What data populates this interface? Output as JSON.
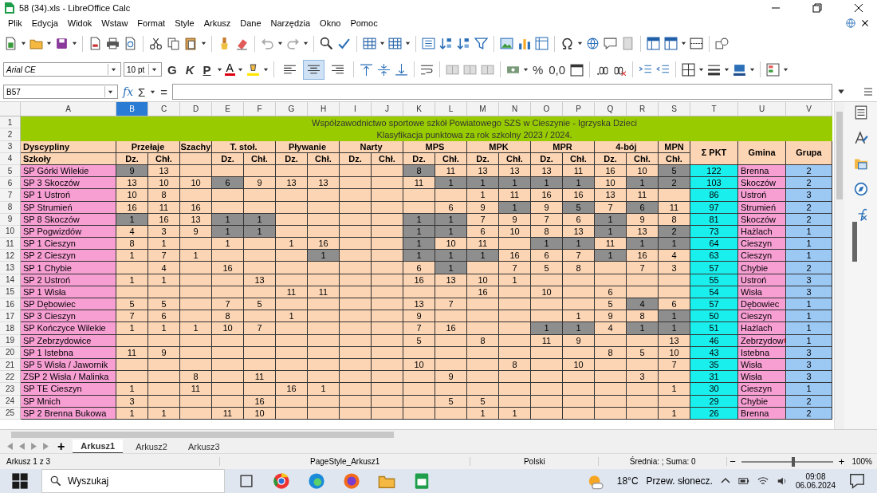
{
  "window": {
    "title": "58 (34).xls - LibreOffice Calc"
  },
  "menu": [
    "Plik",
    "Edycja",
    "Widok",
    "Wstaw",
    "Format",
    "Style",
    "Arkusz",
    "Dane",
    "Narzędzia",
    "Okno",
    "Pomoc"
  ],
  "format_bar": {
    "font": "Arial CE",
    "size": "10 pt",
    "bold": "G",
    "italic": "K",
    "underline": "P",
    "font_color": "A",
    "percent": "%",
    "number_format": "0,0",
    "alignment": [
      {
        "selected": false
      },
      {
        "selected": true
      },
      {
        "selected": false
      }
    ]
  },
  "formula_bar": {
    "cell_ref": "B57",
    "function_wizard": "fx",
    "sum": "Σ",
    "equals": "="
  },
  "sheet": {
    "columns": [
      {
        "label": "A",
        "selected": false
      },
      {
        "label": "B",
        "selected": true
      },
      {
        "label": "C",
        "selected": false
      },
      {
        "label": "D",
        "selected": false
      },
      {
        "label": "E",
        "selected": false
      },
      {
        "label": "F",
        "selected": false
      },
      {
        "label": "G",
        "selected": false
      },
      {
        "label": "H",
        "selected": false
      },
      {
        "label": "I",
        "selected": false
      },
      {
        "label": "J",
        "selected": false
      },
      {
        "label": "K",
        "selected": false
      },
      {
        "label": "L",
        "selected": false
      },
      {
        "label": "M",
        "selected": false
      },
      {
        "label": "N",
        "selected": false
      },
      {
        "label": "O",
        "selected": false
      },
      {
        "label": "P",
        "selected": false
      },
      {
        "label": "Q",
        "selected": false
      },
      {
        "label": "R",
        "selected": false
      },
      {
        "label": "S",
        "selected": false
      },
      {
        "label": "T",
        "selected": false
      },
      {
        "label": "U",
        "selected": false
      },
      {
        "label": "V",
        "selected": false
      }
    ],
    "title_rows": [
      {
        "num": "1",
        "text": "Współzawodnictwo sportowe szkół Powiatowego SZS w Cieszynie - Igrzyska Dzieci"
      },
      {
        "num": "2",
        "text": "Klasyfikacja punktowa za rok szkolny 2023 / 2024."
      }
    ],
    "header": {
      "nums": [
        "3",
        "4"
      ],
      "row_labels": [
        "Dyscypliny",
        "Szkoły"
      ],
      "groups": [
        {
          "label": "Przełaje",
          "subs": [
            "Dz.",
            "Chł."
          ]
        },
        {
          "label": "Szachy"
        },
        {
          "label": "T. stoł.",
          "subs": [
            "Dz.",
            "Chł."
          ]
        },
        {
          "label": "Pływanie",
          "subs": [
            "Dz.",
            "Chł."
          ]
        },
        {
          "label": "Narty",
          "subs": [
            "Dz.",
            "Chł."
          ]
        },
        {
          "label": "MPS",
          "subs": [
            "Dz.",
            "Chł."
          ]
        },
        {
          "label": "MPK",
          "subs": [
            "Dz.",
            "Chł."
          ]
        },
        {
          "label": "MPR",
          "subs": [
            "Dz.",
            "Chł."
          ]
        },
        {
          "label": "4-bój",
          "subs": [
            "Dz.",
            "Chł."
          ]
        },
        {
          "label": "MPN",
          "subs": [
            "Chł."
          ]
        }
      ],
      "total": "Σ PKT",
      "gmina": "Gmina",
      "grupa": "Grupa"
    },
    "rows": [
      {
        "num": "5",
        "school": "SP Górki Wilekie",
        "points": [
          {
            "value": "9",
            "shaded": true
          },
          {
            "value": "13",
            "shaded": false
          },
          {
            "shaded": false
          },
          {
            "shaded": false
          },
          {
            "shaded": false
          },
          {
            "shaded": false
          },
          {
            "shaded": false
          },
          {
            "shaded": false
          },
          {
            "shaded": false
          },
          {
            "value": "8",
            "shaded": true
          },
          {
            "value": "11",
            "shaded": false
          },
          {
            "value": "13",
            "shaded": false
          },
          {
            "value": "13",
            "shaded": false
          },
          {
            "value": "13",
            "shaded": false
          },
          {
            "value": "11",
            "shaded": false
          },
          {
            "value": "16",
            "shaded": false
          },
          {
            "value": "10",
            "shaded": false
          },
          {
            "value": "5",
            "shaded": true
          }
        ],
        "total": "122",
        "gmina": "Brenna",
        "grupa": "2"
      },
      {
        "num": "6",
        "school": "SP 3 Skoczów",
        "points": [
          {
            "value": "13",
            "shaded": false
          },
          {
            "value": "10",
            "shaded": false
          },
          {
            "value": "10",
            "shaded": false
          },
          {
            "value": "6",
            "shaded": true
          },
          {
            "value": "9",
            "shaded": false
          },
          {
            "value": "13",
            "shaded": false
          },
          {
            "value": "13",
            "shaded": false
          },
          {
            "shaded": false
          },
          {
            "shaded": false
          },
          {
            "value": "11",
            "shaded": false
          },
          {
            "value": "1",
            "shaded": true
          },
          {
            "value": "1",
            "shaded": true
          },
          {
            "value": "1",
            "shaded": true
          },
          {
            "value": "1",
            "shaded": true
          },
          {
            "value": "1",
            "shaded": true
          },
          {
            "value": "10",
            "shaded": false
          },
          {
            "value": "1",
            "shaded": true
          },
          {
            "value": "2",
            "shaded": true
          }
        ],
        "total": "103",
        "gmina": "Skoczów",
        "grupa": "2"
      },
      {
        "num": "7",
        "school": "SP 1 Ustroń",
        "points": [
          {
            "value": "10",
            "shaded": false
          },
          {
            "value": "8",
            "shaded": false
          },
          {
            "shaded": false
          },
          {
            "shaded": false
          },
          {
            "shaded": false
          },
          {
            "shaded": false
          },
          {
            "shaded": false
          },
          {
            "shaded": false
          },
          {
            "shaded": false
          },
          {
            "shaded": false
          },
          {
            "shaded": false
          },
          {
            "value": "1",
            "shaded": false
          },
          {
            "value": "11",
            "shaded": false
          },
          {
            "value": "16",
            "shaded": false
          },
          {
            "value": "16",
            "shaded": false
          },
          {
            "value": "13",
            "shaded": false
          },
          {
            "value": "11",
            "shaded": false
          },
          {
            "shaded": false
          }
        ],
        "total": "86",
        "gmina": "Ustroń",
        "grupa": "3"
      },
      {
        "num": "8",
        "school": "SP Strumień",
        "points": [
          {
            "value": "16",
            "shaded": false
          },
          {
            "value": "11",
            "shaded": false
          },
          {
            "value": "16",
            "shaded": false
          },
          {
            "shaded": false
          },
          {
            "shaded": false
          },
          {
            "shaded": false
          },
          {
            "shaded": false
          },
          {
            "shaded": false
          },
          {
            "shaded": false
          },
          {
            "shaded": false
          },
          {
            "value": "6",
            "shaded": false
          },
          {
            "value": "9",
            "shaded": false
          },
          {
            "value": "1",
            "shaded": true
          },
          {
            "value": "9",
            "shaded": false
          },
          {
            "value": "5",
            "shaded": true
          },
          {
            "value": "7",
            "shaded": false
          },
          {
            "value": "6",
            "shaded": true
          },
          {
            "value": "11",
            "shaded": false
          }
        ],
        "total": "97",
        "gmina": "Strumień",
        "grupa": "2"
      },
      {
        "num": "9",
        "school": "SP 8 Skoczów",
        "points": [
          {
            "value": "1",
            "shaded": true
          },
          {
            "value": "16",
            "shaded": false
          },
          {
            "value": "13",
            "shaded": false
          },
          {
            "value": "1",
            "shaded": true
          },
          {
            "value": "1",
            "shaded": true
          },
          {
            "shaded": false
          },
          {
            "shaded": false
          },
          {
            "shaded": false
          },
          {
            "shaded": false
          },
          {
            "value": "1",
            "shaded": true
          },
          {
            "value": "1",
            "shaded": true
          },
          {
            "value": "7",
            "shaded": false
          },
          {
            "value": "9",
            "shaded": false
          },
          {
            "value": "7",
            "shaded": false
          },
          {
            "value": "6",
            "shaded": false
          },
          {
            "value": "1",
            "shaded": true
          },
          {
            "value": "9",
            "shaded": false
          },
          {
            "value": "8",
            "shaded": false
          }
        ],
        "total": "81",
        "gmina": "Skoczów",
        "grupa": "2"
      },
      {
        "num": "10",
        "school": "SP Pogwizdów",
        "points": [
          {
            "value": "4",
            "shaded": false
          },
          {
            "value": "3",
            "shaded": false
          },
          {
            "value": "9",
            "shaded": false
          },
          {
            "value": "1",
            "shaded": true
          },
          {
            "value": "1",
            "shaded": true
          },
          {
            "shaded": false
          },
          {
            "shaded": false
          },
          {
            "shaded": false
          },
          {
            "shaded": false
          },
          {
            "value": "1",
            "shaded": true
          },
          {
            "value": "1",
            "shaded": true
          },
          {
            "value": "6",
            "shaded": false
          },
          {
            "value": "10",
            "shaded": false
          },
          {
            "value": "8",
            "shaded": false
          },
          {
            "value": "13",
            "shaded": false
          },
          {
            "value": "1",
            "shaded": true
          },
          {
            "value": "13",
            "shaded": false
          },
          {
            "value": "2",
            "shaded": true
          }
        ],
        "total": "73",
        "gmina": "Hażlach",
        "grupa": "1"
      },
      {
        "num": "11",
        "school": "SP 1 Cieszyn",
        "points": [
          {
            "value": "8",
            "shaded": false
          },
          {
            "value": "1",
            "shaded": false
          },
          {
            "shaded": false
          },
          {
            "value": "1",
            "shaded": false
          },
          {
            "shaded": false
          },
          {
            "value": "1",
            "shaded": false
          },
          {
            "value": "16",
            "shaded": false
          },
          {
            "shaded": false
          },
          {
            "shaded": false
          },
          {
            "value": "1",
            "shaded": true
          },
          {
            "value": "10",
            "shaded": false
          },
          {
            "value": "11",
            "shaded": false
          },
          {
            "shaded": false
          },
          {
            "value": "1",
            "shaded": true
          },
          {
            "value": "1",
            "shaded": true
          },
          {
            "value": "11",
            "shaded": false
          },
          {
            "value": "1",
            "shaded": true
          },
          {
            "value": "1",
            "shaded": true
          }
        ],
        "total": "64",
        "gmina": "Cieszyn",
        "grupa": "1"
      },
      {
        "num": "12",
        "school": "SP 2 Cieszyn",
        "points": [
          {
            "value": "1",
            "shaded": false
          },
          {
            "value": "7",
            "shaded": false
          },
          {
            "value": "1",
            "shaded": false
          },
          {
            "shaded": false
          },
          {
            "shaded": false
          },
          {
            "shaded": false
          },
          {
            "value": "1",
            "shaded": true
          },
          {
            "shaded": false
          },
          {
            "shaded": false
          },
          {
            "value": "1",
            "shaded": true
          },
          {
            "value": "1",
            "shaded": true
          },
          {
            "value": "1",
            "shaded": true
          },
          {
            "value": "16",
            "shaded": false
          },
          {
            "value": "6",
            "shaded": false
          },
          {
            "value": "7",
            "shaded": false
          },
          {
            "value": "1",
            "shaded": true
          },
          {
            "value": "16",
            "shaded": false
          },
          {
            "value": "4",
            "shaded": false
          }
        ],
        "total": "63",
        "gmina": "Cieszyn",
        "grupa": "1"
      },
      {
        "num": "13",
        "school": "SP 1 Chybie",
        "points": [
          {
            "shaded": false
          },
          {
            "value": "4",
            "shaded": false
          },
          {
            "shaded": false
          },
          {
            "value": "16",
            "shaded": false
          },
          {
            "shaded": false
          },
          {
            "shaded": false
          },
          {
            "shaded": false
          },
          {
            "shaded": false
          },
          {
            "shaded": false
          },
          {
            "value": "6",
            "shaded": false
          },
          {
            "value": "1",
            "shaded": true
          },
          {
            "shaded": false
          },
          {
            "value": "7",
            "shaded": false
          },
          {
            "value": "5",
            "shaded": false
          },
          {
            "value": "8",
            "shaded": false
          },
          {
            "shaded": false
          },
          {
            "value": "7",
            "shaded": false
          },
          {
            "value": "3",
            "shaded": false
          }
        ],
        "total": "57",
        "gmina": "Chybie",
        "grupa": "2"
      },
      {
        "num": "14",
        "school": "SP 2 Ustroń",
        "points": [
          {
            "value": "1",
            "shaded": false
          },
          {
            "value": "1",
            "shaded": false
          },
          {
            "shaded": false
          },
          {
            "shaded": false
          },
          {
            "value": "13",
            "shaded": false
          },
          {
            "shaded": false
          },
          {
            "shaded": false
          },
          {
            "shaded": false
          },
          {
            "shaded": false
          },
          {
            "value": "16",
            "shaded": false
          },
          {
            "value": "13",
            "shaded": false
          },
          {
            "value": "10",
            "shaded": false
          },
          {
            "value": "1",
            "shaded": false
          },
          {
            "shaded": false
          },
          {
            "shaded": false
          },
          {
            "shaded": false
          },
          {
            "shaded": false
          },
          {
            "shaded": false
          }
        ],
        "total": "55",
        "gmina": "Ustroń",
        "grupa": "3"
      },
      {
        "num": "15",
        "school": "SP 1 Wisła",
        "points": [
          {
            "shaded": false
          },
          {
            "shaded": false
          },
          {
            "shaded": false
          },
          {
            "shaded": false
          },
          {
            "shaded": false
          },
          {
            "value": "11",
            "shaded": false
          },
          {
            "value": "11",
            "shaded": false
          },
          {
            "shaded": false
          },
          {
            "shaded": false
          },
          {
            "shaded": false
          },
          {
            "shaded": false
          },
          {
            "value": "16",
            "shaded": false
          },
          {
            "shaded": false
          },
          {
            "value": "10",
            "shaded": false
          },
          {
            "shaded": false
          },
          {
            "value": "6",
            "shaded": false
          },
          {
            "shaded": false
          },
          {
            "shaded": false
          }
        ],
        "total": "54",
        "gmina": "Wisła",
        "grupa": "3"
      },
      {
        "num": "16",
        "school": "SP Dębowiec",
        "points": [
          {
            "value": "5",
            "shaded": false
          },
          {
            "value": "5",
            "shaded": false
          },
          {
            "shaded": false
          },
          {
            "value": "7",
            "shaded": false
          },
          {
            "value": "5",
            "shaded": false
          },
          {
            "shaded": false
          },
          {
            "shaded": false
          },
          {
            "shaded": false
          },
          {
            "shaded": false
          },
          {
            "value": "13",
            "shaded": false
          },
          {
            "value": "7",
            "shaded": false
          },
          {
            "shaded": false
          },
          {
            "shaded": false
          },
          {
            "shaded": false
          },
          {
            "shaded": false
          },
          {
            "value": "5",
            "shaded": false
          },
          {
            "value": "4",
            "shaded": true
          },
          {
            "value": "6",
            "shaded": false
          }
        ],
        "total": "57",
        "gmina": "Dębowiec",
        "grupa": "1"
      },
      {
        "num": "17",
        "school": "SP 3  Cieszyn",
        "points": [
          {
            "value": "7",
            "shaded": false
          },
          {
            "value": "6",
            "shaded": false
          },
          {
            "shaded": false
          },
          {
            "value": "8",
            "shaded": false
          },
          {
            "shaded": false
          },
          {
            "value": "1",
            "shaded": false
          },
          {
            "shaded": false
          },
          {
            "shaded": false
          },
          {
            "shaded": false
          },
          {
            "value": "9",
            "shaded": false
          },
          {
            "shaded": false
          },
          {
            "shaded": false
          },
          {
            "shaded": false
          },
          {
            "shaded": false
          },
          {
            "value": "1",
            "shaded": false
          },
          {
            "value": "9",
            "shaded": false
          },
          {
            "value": "8",
            "shaded": false
          },
          {
            "value": "1",
            "shaded": true
          }
        ],
        "total": "50",
        "gmina": "Cieszyn",
        "grupa": "1"
      },
      {
        "num": "18",
        "school": "SP Kończyce Wilekie",
        "points": [
          {
            "value": "1",
            "shaded": false
          },
          {
            "value": "1",
            "shaded": false
          },
          {
            "value": "1",
            "shaded": false
          },
          {
            "value": "10",
            "shaded": false
          },
          {
            "value": "7",
            "shaded": false
          },
          {
            "shaded": false
          },
          {
            "shaded": false
          },
          {
            "shaded": false
          },
          {
            "shaded": false
          },
          {
            "value": "7",
            "shaded": false
          },
          {
            "value": "16",
            "shaded": false
          },
          {
            "shaded": false
          },
          {
            "shaded": false
          },
          {
            "value": "1",
            "shaded": true
          },
          {
            "value": "1",
            "shaded": true
          },
          {
            "value": "4",
            "shaded": false
          },
          {
            "value": "1",
            "shaded": true
          },
          {
            "value": "1",
            "shaded": true
          }
        ],
        "total": "51",
        "gmina": "Hażlach",
        "grupa": "1"
      },
      {
        "num": "19",
        "school": "SP Zebrzydowice",
        "points": [
          {
            "shaded": false
          },
          {
            "shaded": false
          },
          {
            "shaded": false
          },
          {
            "shaded": false
          },
          {
            "shaded": false
          },
          {
            "shaded": false
          },
          {
            "shaded": false
          },
          {
            "shaded": false
          },
          {
            "shaded": false
          },
          {
            "value": "5",
            "shaded": false
          },
          {
            "shaded": false
          },
          {
            "value": "8",
            "shaded": false
          },
          {
            "shaded": false
          },
          {
            "value": "11",
            "shaded": false
          },
          {
            "value": "9",
            "shaded": false
          },
          {
            "shaded": false
          },
          {
            "shaded": false
          },
          {
            "value": "13",
            "shaded": false
          }
        ],
        "total": "46",
        "gmina": "Zebrzydow",
        "gmina_overflow": true,
        "grupa": "1"
      },
      {
        "num": "20",
        "school": "SP 1 Istebna",
        "points": [
          {
            "value": "11",
            "shaded": false
          },
          {
            "value": "9",
            "shaded": false
          },
          {
            "shaded": false
          },
          {
            "shaded": false
          },
          {
            "shaded": false
          },
          {
            "shaded": false
          },
          {
            "shaded": false
          },
          {
            "shaded": false
          },
          {
            "shaded": false
          },
          {
            "shaded": false
          },
          {
            "shaded": false
          },
          {
            "shaded": false
          },
          {
            "shaded": false
          },
          {
            "shaded": false
          },
          {
            "shaded": false
          },
          {
            "value": "8",
            "shaded": false
          },
          {
            "value": "5",
            "shaded": false
          },
          {
            "value": "10",
            "shaded": false
          }
        ],
        "total": "43",
        "gmina": "Istebna",
        "grupa": "3"
      },
      {
        "num": "21",
        "school": "SP 5 Wisła / Jawornik",
        "points": [
          {
            "shaded": false
          },
          {
            "shaded": false
          },
          {
            "shaded": false
          },
          {
            "shaded": false
          },
          {
            "shaded": false
          },
          {
            "shaded": false
          },
          {
            "shaded": false
          },
          {
            "shaded": false
          },
          {
            "shaded": false
          },
          {
            "value": "10",
            "shaded": false
          },
          {
            "shaded": false
          },
          {
            "shaded": false
          },
          {
            "value": "8",
            "shaded": false
          },
          {
            "shaded": false
          },
          {
            "value": "10",
            "shaded": false
          },
          {
            "shaded": false
          },
          {
            "shaded": false
          },
          {
            "value": "7",
            "shaded": false
          }
        ],
        "total": "35",
        "gmina": "Wisła",
        "grupa": "3"
      },
      {
        "num": "22",
        "school": "ZSP 2 Wisła / Malinka",
        "points": [
          {
            "shaded": false
          },
          {
            "shaded": false
          },
          {
            "value": "8",
            "shaded": false
          },
          {
            "shaded": false
          },
          {
            "value": "11",
            "shaded": false
          },
          {
            "shaded": false
          },
          {
            "shaded": false
          },
          {
            "shaded": false
          },
          {
            "shaded": false
          },
          {
            "shaded": false
          },
          {
            "value": "9",
            "shaded": false
          },
          {
            "shaded": false
          },
          {
            "shaded": false
          },
          {
            "shaded": false
          },
          {
            "shaded": false
          },
          {
            "shaded": false
          },
          {
            "value": "3",
            "shaded": false
          },
          {
            "shaded": false
          }
        ],
        "total": "31",
        "gmina": "Wisła",
        "grupa": "3"
      },
      {
        "num": "23",
        "school": "SP TE Cieszyn",
        "points": [
          {
            "value": "1",
            "shaded": false
          },
          {
            "shaded": false
          },
          {
            "value": "11",
            "shaded": false
          },
          {
            "shaded": false
          },
          {
            "shaded": false
          },
          {
            "value": "16",
            "shaded": false
          },
          {
            "value": "1",
            "shaded": false
          },
          {
            "shaded": false
          },
          {
            "shaded": false
          },
          {
            "shaded": false
          },
          {
            "shaded": false
          },
          {
            "shaded": false
          },
          {
            "shaded": false
          },
          {
            "shaded": false
          },
          {
            "shaded": false
          },
          {
            "shaded": false
          },
          {
            "shaded": false
          },
          {
            "value": "1",
            "shaded": false
          }
        ],
        "total": "30",
        "gmina": "Cieszyn",
        "grupa": "1"
      },
      {
        "num": "24",
        "school": "SP Mnich",
        "points": [
          {
            "value": "3",
            "shaded": false
          },
          {
            "shaded": false
          },
          {
            "shaded": false
          },
          {
            "shaded": false
          },
          {
            "value": "16",
            "shaded": false
          },
          {
            "shaded": false
          },
          {
            "shaded": false
          },
          {
            "shaded": false
          },
          {
            "shaded": false
          },
          {
            "shaded": false
          },
          {
            "value": "5",
            "shaded": false
          },
          {
            "value": "5",
            "shaded": false
          },
          {
            "shaded": false
          },
          {
            "shaded": false
          },
          {
            "shaded": false
          },
          {
            "shaded": false
          },
          {
            "shaded": false
          },
          {
            "shaded": false
          }
        ],
        "total": "29",
        "gmina": "Chybie",
        "grupa": "2"
      },
      {
        "num": "25",
        "school": "SP 2 Brenna Bukowa",
        "points": [
          {
            "value": "1",
            "shaded": false
          },
          {
            "value": "1",
            "shaded": false
          },
          {
            "shaded": false
          },
          {
            "value": "11",
            "shaded": false
          },
          {
            "value": "10",
            "shaded": false
          },
          {
            "shaded": false
          },
          {
            "shaded": false
          },
          {
            "shaded": false
          },
          {
            "shaded": false
          },
          {
            "shaded": false
          },
          {
            "shaded": false
          },
          {
            "value": "1",
            "shaded": false
          },
          {
            "value": "1",
            "shaded": false
          },
          {
            "shaded": false
          },
          {
            "shaded": false
          },
          {
            "shaded": false
          },
          {
            "shaded": false
          },
          {
            "value": "1",
            "shaded": false
          }
        ],
        "total": "26",
        "gmina": "Brenna",
        "grupa": "2"
      }
    ]
  },
  "sheet_tabs": {
    "add": "+",
    "tabs": [
      {
        "label": "Arkusz1",
        "selected": true
      },
      {
        "label": "Arkusz2",
        "selected": false
      },
      {
        "label": "Arkusz3",
        "selected": false
      }
    ]
  },
  "status_bar": {
    "sheet": "Arkusz 1 z 3",
    "page_style": "PageStyle_Arkusz1",
    "language": "Polski",
    "summary": "Średnia: ; Suma: 0",
    "zoom_out": "−",
    "zoom_in": "+",
    "zoom_slider": {
      "level": 0.55
    },
    "zoom": "100%"
  },
  "taskbar": {
    "search": "Wyszukaj",
    "temperature": "18°C",
    "weather": "Przew. słonecz.",
    "time": "09:08",
    "date": "06.06.2024"
  }
}
